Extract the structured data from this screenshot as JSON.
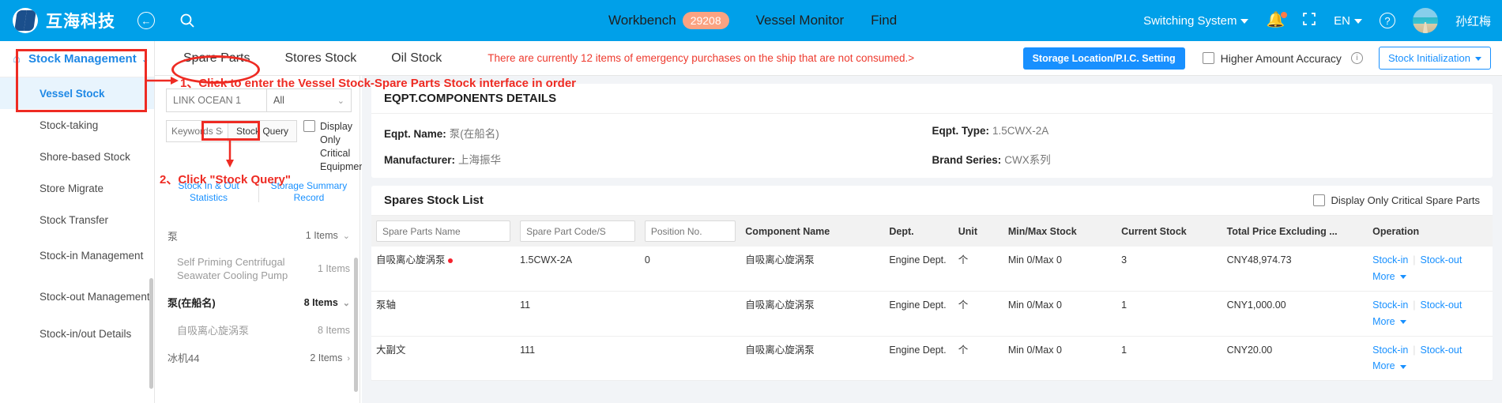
{
  "header": {
    "brand": "互海科技",
    "back_icon": "arrow-left-icon",
    "search_icon": "search-icon",
    "nav": [
      {
        "label": "Workbench",
        "badge": "29208"
      },
      {
        "label": "Vessel Monitor",
        "badge": ""
      },
      {
        "label": "Find",
        "badge": ""
      }
    ],
    "switching_system": "Switching System",
    "language": "EN",
    "bell_icon": "bell-icon",
    "fullscreen_icon": "fullscreen-icon",
    "help_icon": "help-circle-icon",
    "user_name": "孙红梅"
  },
  "sidebar": {
    "home_icon": "home-icon",
    "title": "Stock Management",
    "items": [
      {
        "label": "Vessel Stock",
        "active": true
      },
      {
        "label": "Stock-taking",
        "active": false
      },
      {
        "label": "Shore-based Stock",
        "active": false
      },
      {
        "label": "Store Migrate",
        "active": false
      },
      {
        "label": "Stock Transfer",
        "active": false
      },
      {
        "label": "Stock-in Management",
        "active": false
      },
      {
        "label": "Stock-out Management",
        "active": false
      },
      {
        "label": "Stock-in/out Details",
        "active": false
      }
    ]
  },
  "tabbar": {
    "tabs": [
      {
        "label": "Spare Parts",
        "active": true
      },
      {
        "label": "Stores Stock",
        "active": false
      },
      {
        "label": "Oil Stock",
        "active": false
      }
    ],
    "warning": "There are currently 12 items of emergency purchases on the ship that are not consumed.>",
    "storage_setting_button": "Storage Location/P.I.C. Setting",
    "higher_amount_accuracy": "Higher Amount Accuracy",
    "stock_initialization": "Stock Initialization"
  },
  "filter": {
    "vessel_value": "LINK OCEAN 1",
    "vessel_placeholder": "LINK OCEAN 1",
    "category_value": "All",
    "keywords_placeholder": "Keywords Se",
    "stock_query_button": "Stock Query",
    "critical_checkbox": "Display Only Critical Equipment",
    "link_in_out": "Stock In & Out Statistics",
    "link_summary": "Storage Summary Record",
    "tree": [
      {
        "name": "泵",
        "count": "1 Items",
        "type": "group",
        "chevron": "⌄"
      },
      {
        "name": "Self Priming Centrifugal Seawater Cooling Pump",
        "count": "1 Items",
        "type": "child",
        "chevron": ""
      },
      {
        "name": "泵(在船名)",
        "count": "8 Items",
        "type": "group-bold",
        "chevron": "⌄"
      },
      {
        "name": "自吸离心旋涡泵",
        "count": "8 Items",
        "type": "child",
        "chevron": ""
      },
      {
        "name": "冰机44",
        "count": "2 Items",
        "type": "group",
        "chevron": "›"
      }
    ]
  },
  "details": {
    "title": "EQPT.COMPONENTS DETAILS",
    "fields": [
      {
        "label": "Eqpt. Name:",
        "value": "泵(在船名)"
      },
      {
        "label": "Eqpt. Type:",
        "value": "1.5CWX-2A"
      },
      {
        "label": "Manufacturer:",
        "value": "上海振华"
      },
      {
        "label": "Brand Series:",
        "value": "CWX系列"
      }
    ]
  },
  "stock_list": {
    "title": "Spares Stock List",
    "critical_checkbox": "Display Only Critical Spare Parts",
    "columns": [
      {
        "label": "Spare Parts Name",
        "filter": true
      },
      {
        "label": "Spare Part Code/S",
        "filter": true
      },
      {
        "label": "Position No.",
        "filter": true
      },
      {
        "label": "Component Name",
        "filter": false
      },
      {
        "label": "Dept.",
        "filter": false
      },
      {
        "label": "Unit",
        "filter": false
      },
      {
        "label": "Min/Max Stock",
        "filter": false
      },
      {
        "label": "Current Stock",
        "filter": false
      },
      {
        "label": "Total Price Excluding ...",
        "filter": false
      },
      {
        "label": "Operation",
        "filter": false
      }
    ],
    "rows": [
      {
        "name": "自吸离心旋涡泵",
        "critical": true,
        "code": "1.5CWX-2A",
        "position": "0",
        "component": "自吸离心旋涡泵",
        "dept": "Engine Dept.",
        "unit": "个",
        "minmax": "Min 0/Max 0",
        "current": "3",
        "price": "CNY48,974.73",
        "op_in": "Stock-in",
        "op_out": "Stock-out",
        "op_more": "More"
      },
      {
        "name": "泵轴",
        "critical": false,
        "code": "11",
        "position": "",
        "component": "自吸离心旋涡泵",
        "dept": "Engine Dept.",
        "unit": "个",
        "minmax": "Min 0/Max 0",
        "current": "1",
        "price": "CNY1,000.00",
        "op_in": "Stock-in",
        "op_out": "Stock-out",
        "op_more": "More"
      },
      {
        "name": "大副文",
        "critical": false,
        "code": "111",
        "position": "",
        "component": "自吸离心旋涡泵",
        "dept": "Engine Dept.",
        "unit": "个",
        "minmax": "Min 0/Max 0",
        "current": "1",
        "price": "CNY20.00",
        "op_in": "Stock-in",
        "op_out": "Stock-out",
        "op_more": "More"
      }
    ]
  },
  "annotations": {
    "step1": "1、Click to enter the Vessel Stock-Spare Parts Stock interface in order",
    "step2": "2、Click \"Stock Query\"",
    "accent_red": "#ee2b23"
  }
}
